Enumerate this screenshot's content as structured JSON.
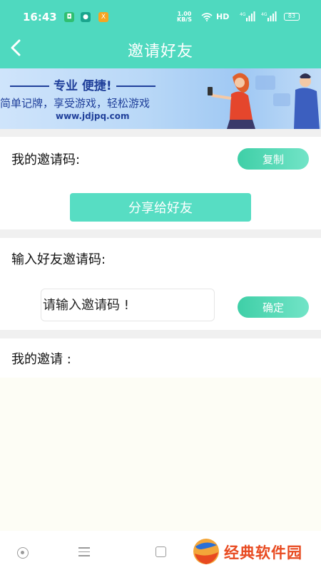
{
  "status_bar": {
    "time": "16:43",
    "net_speed_value": "1.00",
    "net_speed_unit": "KB/S",
    "hd": "HD",
    "signal_1": "4G",
    "signal_2": "4G",
    "battery": "83"
  },
  "header": {
    "title": "邀请好友",
    "back_icon": "chevron-left-icon"
  },
  "banner": {
    "slogan": "专业  便捷!",
    "tagline": "简单记牌，享受游戏，轻松游戏",
    "url": "www.jdjpq.com"
  },
  "my_code": {
    "label": "我的邀请码:",
    "copy_button": "复制",
    "share_button": "分享给好友"
  },
  "enter_code": {
    "label": "输入好友邀请码:",
    "placeholder": "请输入邀请码 !",
    "confirm_button": "确定"
  },
  "my_invites": {
    "label": "我的邀请 :"
  },
  "watermark": {
    "text": "经典软件园"
  },
  "colors": {
    "primary": "#4fd9bf",
    "button": "#57ddc3",
    "watermark": "#e84a20"
  }
}
